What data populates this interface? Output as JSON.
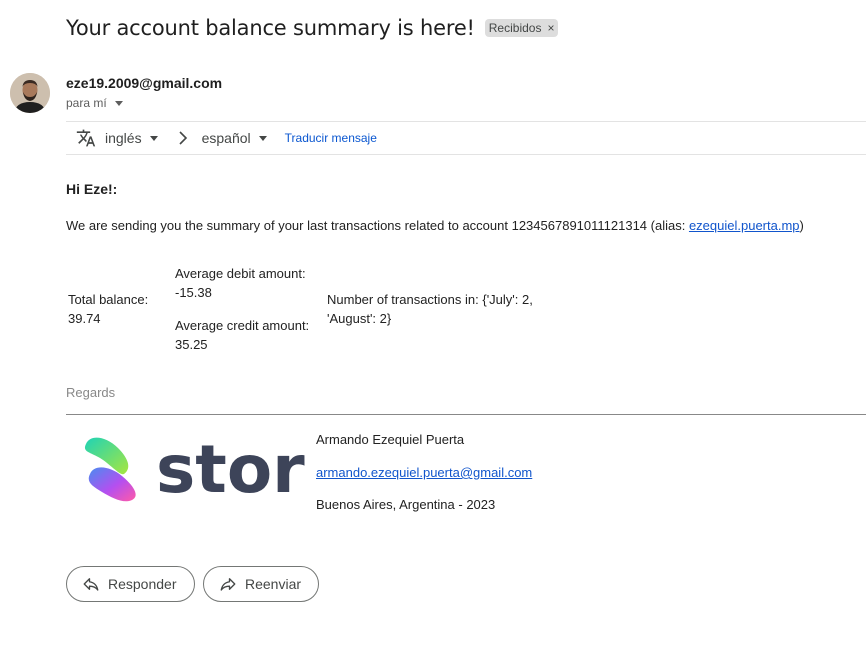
{
  "email": {
    "subject": "Your account balance summary is here!",
    "label": "Recibidos",
    "label_remove": "×",
    "sender": "eze19.2009@gmail.com",
    "recipient": "para mí"
  },
  "translate_bar": {
    "from_lang": "inglés",
    "to_lang": "español",
    "action": "Traducir mensaje"
  },
  "body": {
    "greeting": "Hi Eze!:",
    "intro_before": "We are sending you the summary of your last transactions related to account 1234567891011121314 (alias: ",
    "alias": "ezequiel.puerta.mp",
    "intro_after": ")",
    "total_balance_label": "Total balance:",
    "total_balance_value": "39.74",
    "avg_debit_label": "Average debit amount:",
    "avg_debit_value": "-15.38",
    "avg_credit_label": "Average credit amount:",
    "avg_credit_value": "35.25",
    "transactions_label": "Number of transactions in: {'July': 2, 'August': 2}",
    "regards": "Regards"
  },
  "signature": {
    "name": "Armando Ezequiel Puerta",
    "email": "armando.ezequiel.puerta@gmail.com",
    "location": "Buenos Aires, Argentina - 2023",
    "logo_text": "stori"
  },
  "actions": {
    "reply": "Responder",
    "forward": "Reenviar"
  },
  "colors": {
    "link": "#1155cc",
    "logo_text": "#3d4459"
  }
}
